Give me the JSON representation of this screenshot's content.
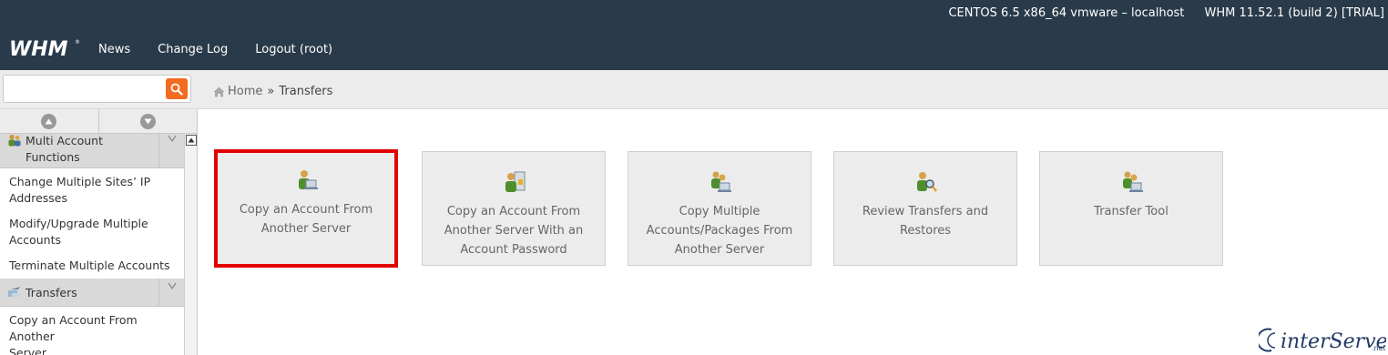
{
  "header": {
    "server": "CENTOS 6.5 x86_64 vmware – localhost",
    "version": "WHM 11.52.1 (build 2) [TRIAL]",
    "logo": "WHM",
    "nav": [
      "News",
      "Change Log",
      "Logout (root)"
    ]
  },
  "search": {
    "placeholder": "",
    "value": ""
  },
  "breadcrumb": {
    "home": "Home",
    "separator": "»",
    "current": "Transfers"
  },
  "sidebar": {
    "section1": {
      "title_line1": "Multi Account",
      "title_line2": "Functions",
      "icon": "users-icon"
    },
    "section1_items": [
      {
        "line1": "Change Multiple Sites’ IP",
        "line2": "Addresses"
      },
      {
        "line1": "Modify/Upgrade Multiple",
        "line2": "Accounts"
      },
      {
        "line1": "Terminate Multiple Accounts",
        "line2": ""
      }
    ],
    "section2": {
      "title": "Transfers",
      "icon": "transfer-icon"
    },
    "section2_items": [
      {
        "line1": "Copy an Account From Another",
        "line2": "Server"
      }
    ]
  },
  "cards": [
    {
      "lines": [
        "Copy an Account From",
        "Another Server",
        ""
      ],
      "icon": "copy-account-icon",
      "selected": true
    },
    {
      "lines": [
        "Copy an Account From",
        "Another Server With an",
        "Account Password"
      ],
      "icon": "copy-account-password-icon",
      "selected": false
    },
    {
      "lines": [
        "Copy Multiple",
        "Accounts/Packages From",
        "Another Server"
      ],
      "icon": "copy-multiple-icon",
      "selected": false
    },
    {
      "lines": [
        "Review Transfers and",
        "Restores",
        ""
      ],
      "icon": "review-transfers-icon",
      "selected": false
    },
    {
      "lines": [
        "Transfer Tool",
        "",
        ""
      ],
      "icon": "transfer-tool-icon",
      "selected": false
    }
  ],
  "brand": {
    "text": "interServer",
    "suffix": ".net"
  },
  "colors": {
    "header_bg": "#293a4a",
    "search_button": "#f26c20",
    "selection": "#e30000",
    "card_bg": "#ececec"
  }
}
